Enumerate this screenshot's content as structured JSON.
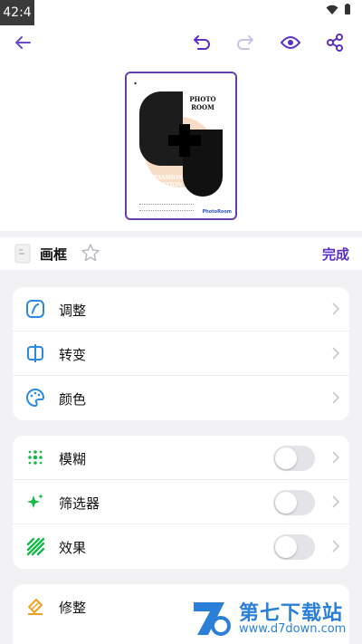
{
  "status_bar": {
    "time": "42:4"
  },
  "header": {
    "title": "画框",
    "done_label": "完成"
  },
  "poster": {
    "title": "PHOTO ROOM",
    "subtitle": "FASHION EDITION",
    "brand": "PhotoRoom"
  },
  "sections": {
    "adjust": [
      {
        "label": "调整",
        "icon": "adjust-icon"
      },
      {
        "label": "转变",
        "icon": "transform-icon"
      },
      {
        "label": "颜色",
        "icon": "palette-icon"
      }
    ],
    "effects": [
      {
        "label": "模糊",
        "icon": "blur-icon",
        "enabled": false
      },
      {
        "label": "筛选器",
        "icon": "filter-sparkle-icon",
        "enabled": false
      },
      {
        "label": "效果",
        "icon": "effects-stripes-icon",
        "enabled": false
      }
    ],
    "more": [
      {
        "label": "修整",
        "icon": "retouch-icon"
      }
    ]
  },
  "watermark": {
    "text": "第七下载站",
    "url": "www.d7down.com"
  },
  "colors": {
    "accent": "#5b2fc7",
    "blue_icon": "#2a8ae0",
    "green_icon": "#16b84a"
  }
}
